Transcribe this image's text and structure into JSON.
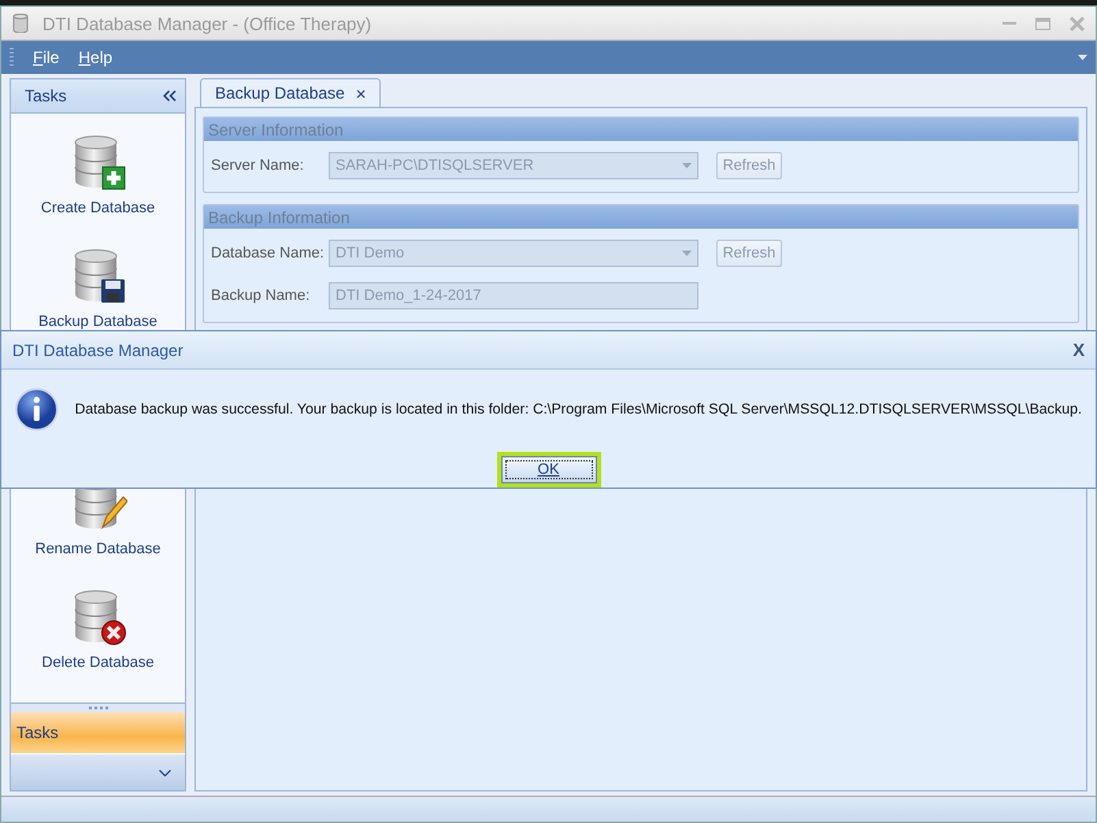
{
  "window": {
    "title": "DTI Database Manager - (Office Therapy)"
  },
  "menu": [
    {
      "label": "File"
    },
    {
      "label": "Help"
    }
  ],
  "sidebar": {
    "header": "Tasks",
    "top_items": [
      {
        "label": "Create Database",
        "kind": "create"
      },
      {
        "label": "Backup Database",
        "kind": "backup"
      }
    ],
    "bottom_items": [
      {
        "label": "Rename Database",
        "kind": "rename"
      },
      {
        "label": "Delete Database",
        "kind": "delete"
      }
    ],
    "nav_buttons": [
      {
        "label": "Tasks",
        "selected": true
      }
    ]
  },
  "tabs": [
    {
      "label": "Backup Database",
      "selected": true,
      "close": "×"
    }
  ],
  "groups": [
    {
      "title": "Server Information",
      "fields": [
        {
          "label": "Server Name:",
          "kind": "combo",
          "value": "SARAH-PC\\DTISQLSERVER",
          "disabled": true,
          "button": "Refresh"
        }
      ]
    },
    {
      "title": "Backup Information",
      "fields": [
        {
          "label": "Database Name:",
          "kind": "combo",
          "value": "DTI Demo",
          "disabled": true,
          "button": "Refresh"
        },
        {
          "label": "Backup Name:",
          "kind": "text",
          "value": "DTI Demo_1-24-2017",
          "disabled": true
        }
      ]
    }
  ],
  "dialog": {
    "title": "DTI Database Manager",
    "close": "X",
    "message": "Database backup was successful. Your backup is located in this folder: C:\\Program Files\\Microsoft SQL Server\\MSSQL12.DTISQLSERVER\\MSSQL\\Backup.",
    "button": "OK"
  }
}
